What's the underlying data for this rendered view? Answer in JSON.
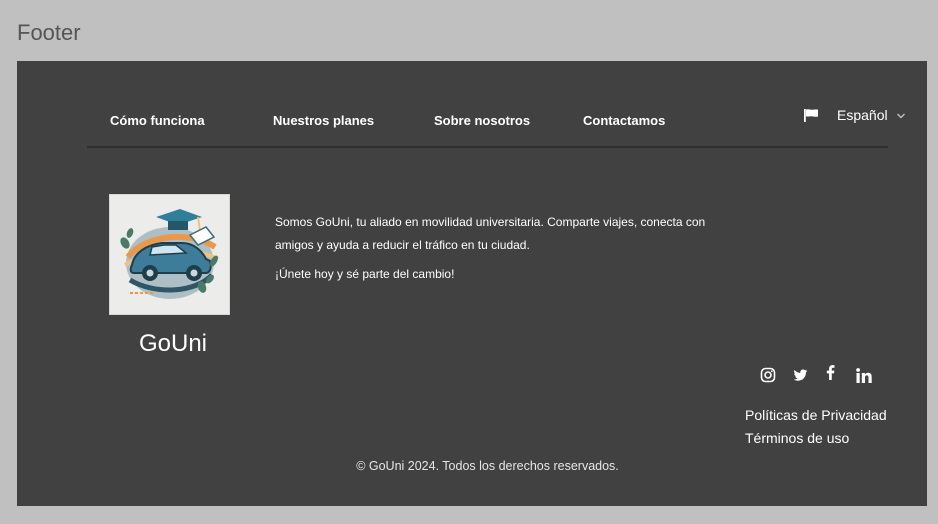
{
  "page": {
    "label": "Footer"
  },
  "nav": {
    "items": [
      {
        "label": "Cómo funciona"
      },
      {
        "label": "Nuestros planes"
      },
      {
        "label": "Sobre nosotros"
      },
      {
        "label": "Contactamos"
      }
    ],
    "language": {
      "label": "Español",
      "icon": "flag-icon"
    }
  },
  "brand": {
    "name": "GoUni",
    "description": "Somos GoUni, tu aliado en movilidad universitaria. Comparte viajes, conecta con amigos y ayuda a reducir el tráfico en tu ciudad.",
    "cta": "¡Únete hoy y sé parte del cambio!"
  },
  "social": [
    "instagram-icon",
    "twitter-icon",
    "facebook-icon",
    "linkedin-icon"
  ],
  "legal": {
    "privacy": "Políticas de Privacidad",
    "terms": "Términos de uso"
  },
  "copyright": "© GoUni 2024. Todos los derechos reservados.",
  "colors": {
    "footer_bg": "#414141",
    "page_bg": "#c0c0c0"
  }
}
